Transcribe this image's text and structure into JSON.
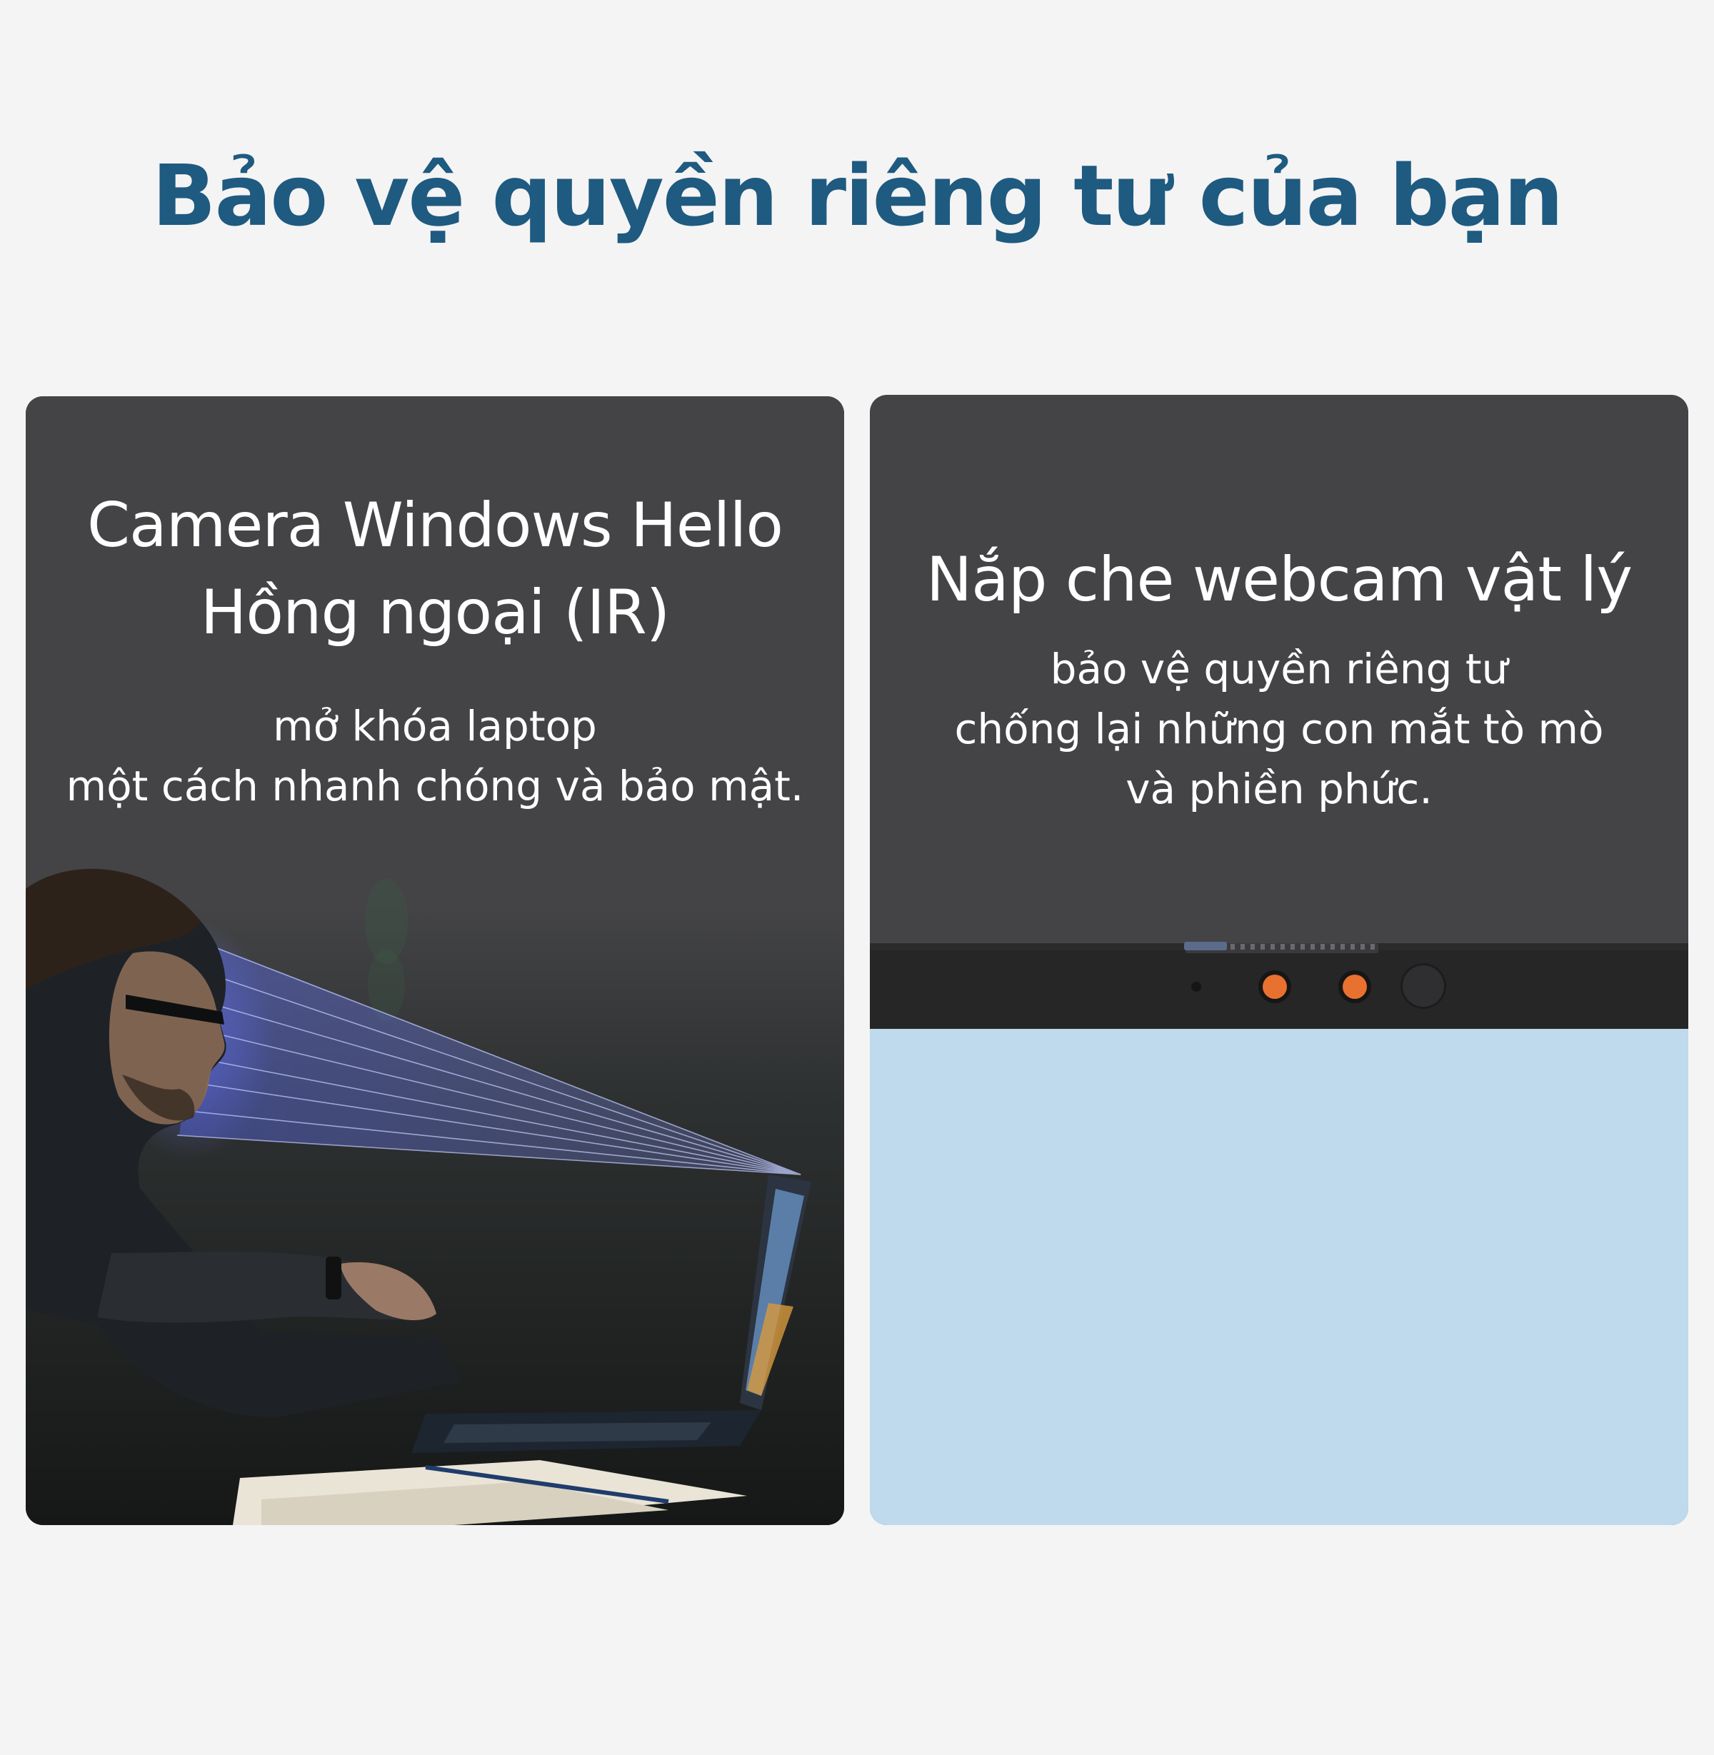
{
  "header": {
    "title": "Bảo vệ quyền riêng tư của bạn"
  },
  "features": [
    {
      "heading": [
        "Camera Windows Hello",
        "Hồng ngoại (IR)"
      ],
      "description": [
        "mở khóa laptop",
        "một cách nhanh chóng và bảo mật."
      ],
      "image": "man-facing-laptop-with-ir-face-scan"
    },
    {
      "heading": [
        "Nắp che webcam vật lý"
      ],
      "description": [
        "bảo vệ quyền riêng tư",
        "chống lại những con mắt tò mò",
        "và phiền phức."
      ],
      "image": "laptop-bezel-with-webcam-shutter"
    }
  ],
  "colors": {
    "title": "#1f5a80",
    "page_background": "#f4f4f4",
    "card_background": "#444446",
    "card_text": "#ffffff",
    "webcam_indicator": "#e9712f",
    "screen": "#bfd9ed"
  }
}
